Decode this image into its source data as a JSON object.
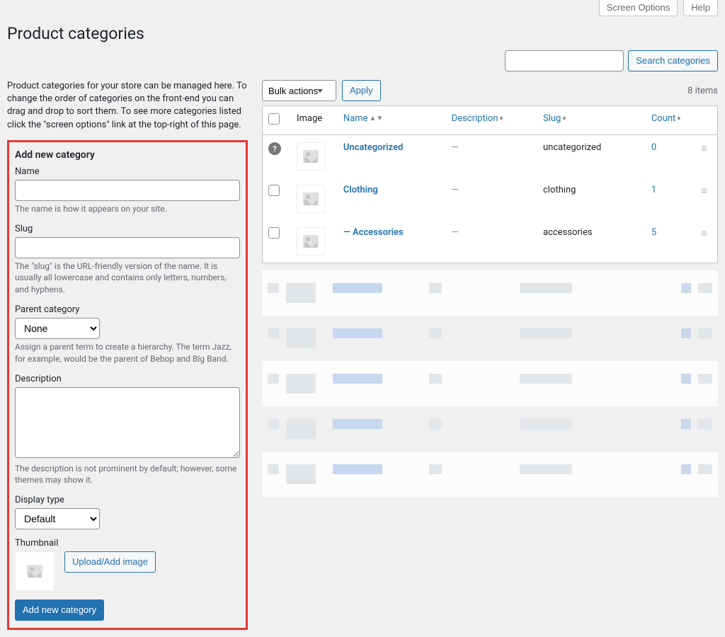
{
  "header": {
    "screen_options": "Screen Options",
    "help": "Help"
  },
  "page_title": "Product categories",
  "search": {
    "button": "Search categories"
  },
  "intro": "Product categories for your store can be managed here. To change the order of categories on the front-end you can drag and drop to sort them. To see more categories listed click the \"screen options\" link at the top-right of this page.",
  "form": {
    "heading": "Add new category",
    "name_label": "Name",
    "name_help": "The name is how it appears on your site.",
    "slug_label": "Slug",
    "slug_help": "The \"slug\" is the URL-friendly version of the name. It is usually all lowercase and contains only letters, numbers, and hyphens.",
    "parent_label": "Parent category",
    "parent_value": "None",
    "parent_help": "Assign a parent term to create a hierarchy. The term Jazz, for example, would be the parent of Bebop and Big Band.",
    "description_label": "Description",
    "description_help": "The description is not prominent by default; however, some themes may show it.",
    "display_label": "Display type",
    "display_value": "Default",
    "thumbnail_label": "Thumbnail",
    "upload_button": "Upload/Add image",
    "submit": "Add new category"
  },
  "table": {
    "bulk_value": "Bulk actions",
    "apply": "Apply",
    "items_count": "8 items",
    "columns": {
      "image": "Image",
      "name": "Name",
      "description": "Description",
      "slug": "Slug",
      "count": "Count"
    },
    "rows": [
      {
        "name": "Uncategorized",
        "description": "—",
        "slug": "uncategorized",
        "count": "0",
        "help": true
      },
      {
        "name": "Clothing",
        "description": "—",
        "slug": "clothing",
        "count": "1",
        "help": false
      },
      {
        "name": "— Accessories",
        "description": "—",
        "slug": "accessories",
        "count": "5",
        "help": false
      }
    ]
  }
}
